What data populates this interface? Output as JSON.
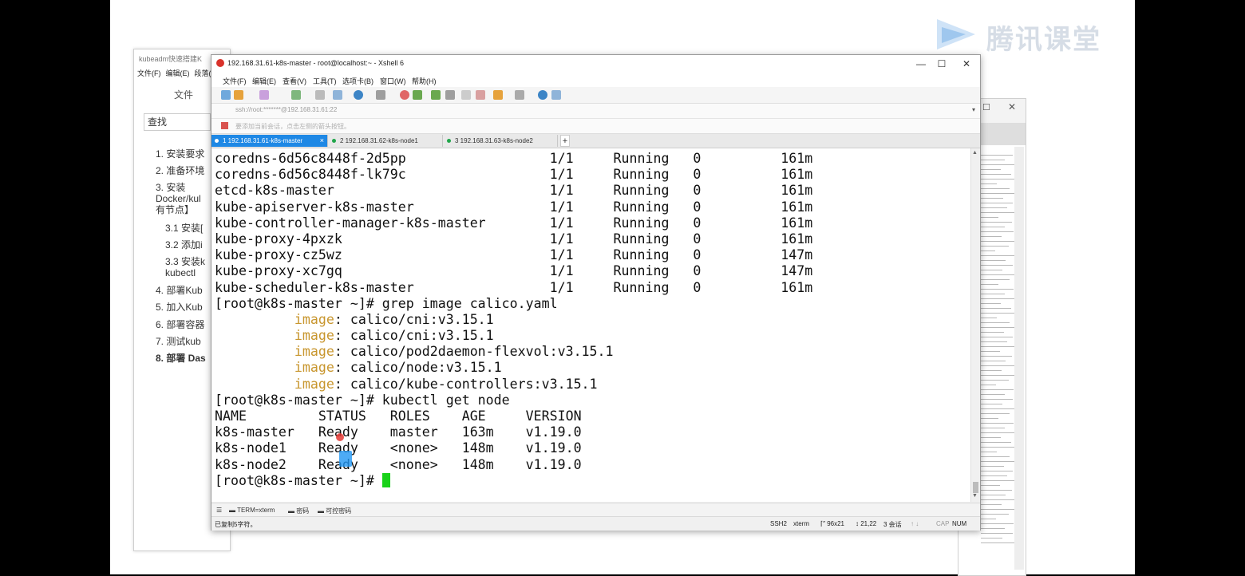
{
  "watermark": {
    "brand": "腾讯课堂"
  },
  "doc_window": {
    "title": "kubeadm快速搭建K",
    "menu": [
      "文件(F)",
      "编辑(E)",
      "段落(P"
    ],
    "file_tab": "文件",
    "search_placeholder": "查找",
    "toc": [
      "1. 安装要求",
      "2. 准备环境",
      "3. 安装",
      "Docker/kul",
      "有节点】",
      "3.1 安装[",
      "3.2 添加i",
      "3.3 安装k",
      "kubectl",
      "4. 部署Kub",
      "5. 加入Kub",
      "6. 部署容器",
      "7. 测试kub",
      "8. 部署 Das"
    ]
  },
  "xshell": {
    "title": "192.168.31.61-k8s-master - root@localhost:~ - Xshell 6",
    "window_buttons": {
      "minimize": "—",
      "maximize": "☐",
      "close": "✕"
    },
    "menu": [
      "文件(F)",
      "编辑(E)",
      "查看(V)",
      "工具(T)",
      "选项卡(B)",
      "窗口(W)",
      "帮助(H)"
    ],
    "address": "ssh://root:*******@192.168.31.61:22",
    "hint": "要添加当前会话，点击左侧的箭头按钮。",
    "tabs": [
      {
        "label": "1 192.168.31.61-k8s-master",
        "active": true
      },
      {
        "label": "2 192.168.31.62-k8s-node1",
        "active": false
      },
      {
        "label": "3 192.168.31.63-k8s-node2",
        "active": false
      }
    ],
    "tab_add": "+",
    "terminal": {
      "pods": [
        {
          "name": "coredns-6d56c8448f-2d5pp",
          "ready": "1/1",
          "status": "Running",
          "restarts": "0",
          "age": "161m"
        },
        {
          "name": "coredns-6d56c8448f-lk79c",
          "ready": "1/1",
          "status": "Running",
          "restarts": "0",
          "age": "161m"
        },
        {
          "name": "etcd-k8s-master",
          "ready": "1/1",
          "status": "Running",
          "restarts": "0",
          "age": "161m"
        },
        {
          "name": "kube-apiserver-k8s-master",
          "ready": "1/1",
          "status": "Running",
          "restarts": "0",
          "age": "161m"
        },
        {
          "name": "kube-controller-manager-k8s-master",
          "ready": "1/1",
          "status": "Running",
          "restarts": "0",
          "age": "161m"
        },
        {
          "name": "kube-proxy-4pxzk",
          "ready": "1/1",
          "status": "Running",
          "restarts": "0",
          "age": "161m"
        },
        {
          "name": "kube-proxy-cz5wz",
          "ready": "1/1",
          "status": "Running",
          "restarts": "0",
          "age": "147m"
        },
        {
          "name": "kube-proxy-xc7gq",
          "ready": "1/1",
          "status": "Running",
          "restarts": "0",
          "age": "147m"
        },
        {
          "name": "kube-scheduler-k8s-master",
          "ready": "1/1",
          "status": "Running",
          "restarts": "0",
          "age": "161m"
        }
      ],
      "prompt": "[root@k8s-master ~]# ",
      "cmd_grep": "grep image calico.yaml",
      "image_keyword": "image",
      "images": [
        "calico/cni:v3.15.1",
        "calico/cni:v3.15.1",
        "calico/pod2daemon-flexvol:v3.15.1",
        "calico/node:v3.15.1",
        "calico/kube-controllers:v3.15.1"
      ],
      "cmd_nodes": "kubectl get node",
      "node_headers": [
        "NAME",
        "STATUS",
        "ROLES",
        "AGE",
        "VERSION"
      ],
      "nodes": [
        {
          "name": "k8s-master",
          "status": "Ready",
          "roles": "master",
          "age": "163m",
          "version": "v1.19.0"
        },
        {
          "name": "k8s-node1",
          "status": "Ready",
          "roles": "<none>",
          "age": "148m",
          "version": "v1.19.0"
        },
        {
          "name": "k8s-node2",
          "status": "Ready",
          "roles": "<none>",
          "age": "148m",
          "version": "v1.19.0"
        }
      ]
    },
    "bottom_bar": [
      "TERM=xterm",
      "密码",
      "可控密码"
    ],
    "status_bar": {
      "left": "已复制5字符。",
      "protocol": "SSH2",
      "term": "xterm",
      "size": "96x21",
      "pos": "21,22",
      "sessions": "3 会话",
      "cap": "CAP",
      "num": "NUM"
    }
  },
  "colors": {
    "tab_active": "#1e88e5",
    "cursor": "#19d219",
    "image_keyword": "#c8962e"
  }
}
